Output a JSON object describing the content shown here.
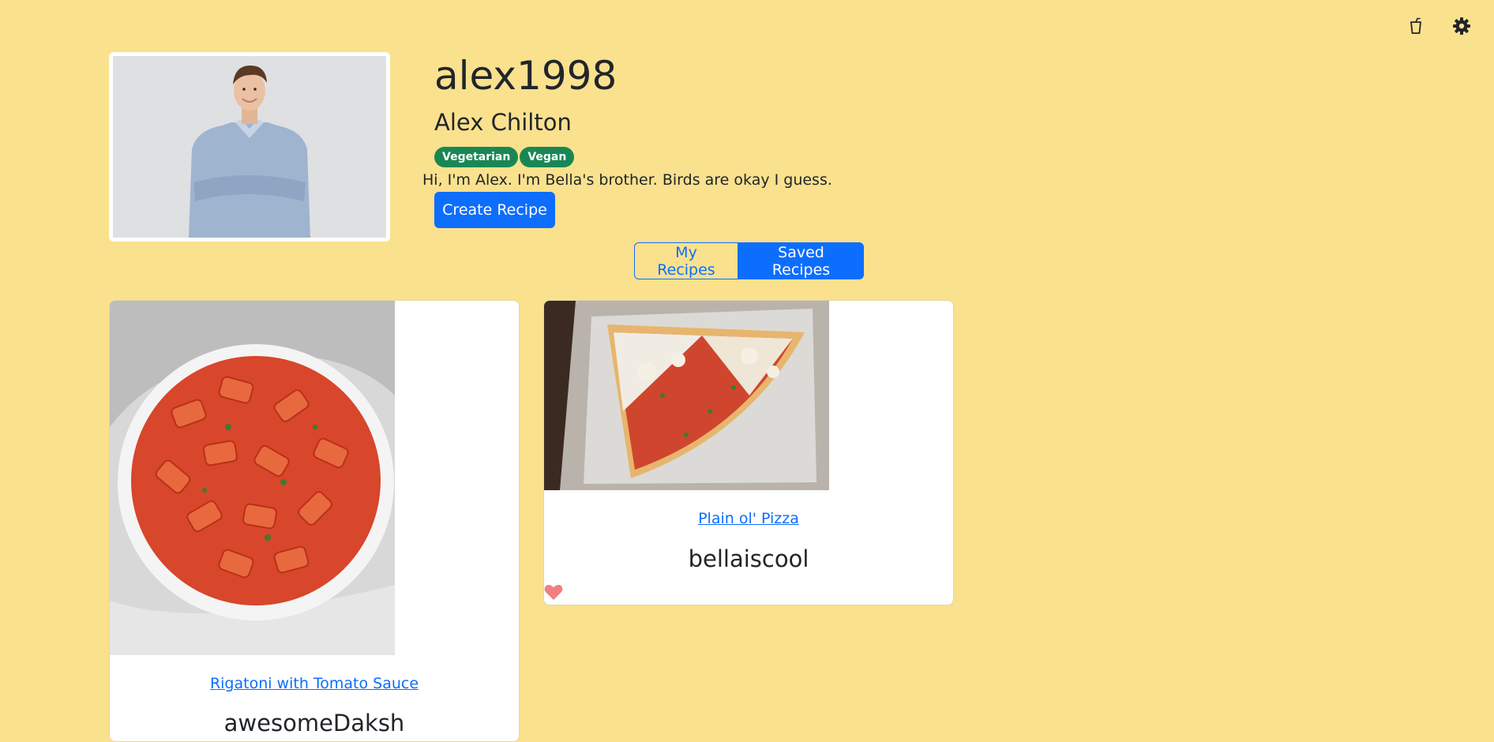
{
  "toolbar": {
    "cup_icon": "cup-icon",
    "gear_icon": "gear-icon"
  },
  "profile": {
    "username": "alex1998",
    "full_name": "Alex Chilton",
    "tags": [
      "Vegetarian",
      "Vegan"
    ],
    "bio": "Hi, I'm Alex. I'm Bella's brother. Birds are okay I guess.",
    "create_button": "Create Recipe"
  },
  "tabs": {
    "my_recipes": "My Recipes",
    "saved_recipes": "Saved Recipes",
    "active": "Saved Recipes"
  },
  "recipes": [
    {
      "title": "Rigatoni with Tomato Sauce",
      "author": "awesomeDaksh"
    },
    {
      "title": "Plain ol' Pizza",
      "author": "bellaiscool",
      "favorited": true
    }
  ],
  "colors": {
    "background": "#fae18e",
    "primary": "#0d6efd",
    "badge": "#198754",
    "heart": "#f08080"
  }
}
